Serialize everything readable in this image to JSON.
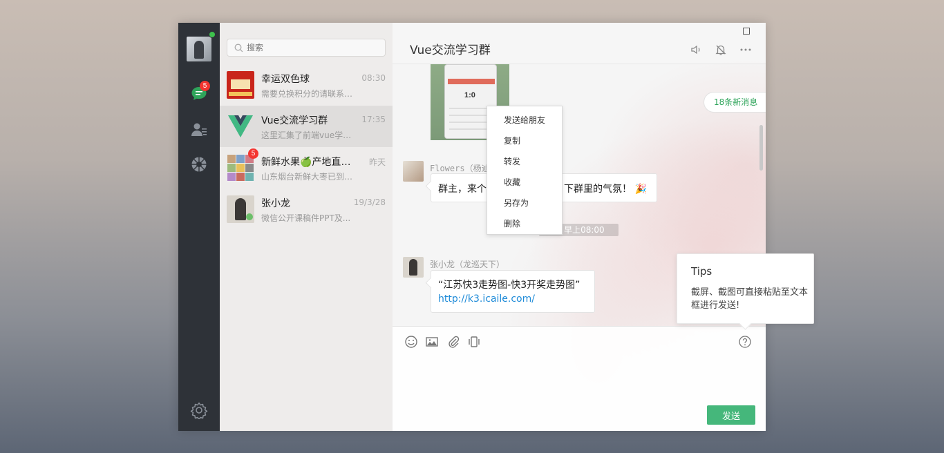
{
  "sidebar": {
    "chat_badge": "5",
    "icons": [
      "chat-icon",
      "contacts-icon",
      "moments-icon",
      "settings-icon"
    ]
  },
  "search": {
    "placeholder": "搜索"
  },
  "conversations": [
    {
      "name": "幸运双色球",
      "time": "08:30",
      "preview": "需要兑换积分的请联系Q...",
      "badge": ""
    },
    {
      "name": "Vue交流学习群",
      "time": "17:35",
      "preview": "这里汇集了前端vue学习...",
      "badge": ""
    },
    {
      "name": "新鲜水果🍏产地直邮...",
      "time": "昨天",
      "preview": "山东烟台新鲜大枣已到，欢...",
      "badge": "5"
    },
    {
      "name": "张小龙",
      "time": "19/3/28",
      "preview": "微信公开课稿件PPT及...",
      "badge": ""
    }
  ],
  "chat": {
    "title": "Vue交流学习群",
    "new_messages": "18条新消息",
    "time_divider": "日 早上08:00",
    "messages": [
      {
        "sender": "Flowers（杨迪",
        "text_left": "群主，来个",
        "text_right": "下群里的气氛！ 🎉"
      },
      {
        "sender": "张小龙（龙巡天下）",
        "quote": "“江苏快3走势图-快3开奖走势图”",
        "link": "http://k3.icaile.com/"
      }
    ],
    "image_score": "1:0"
  },
  "context_menu": [
    "发送给朋友",
    "复制",
    "转发",
    "收藏",
    "另存为",
    "删除"
  ],
  "tips": {
    "title": "Tips",
    "text": "截屏、截图可直接粘贴至文本框进行发送!"
  },
  "composer": {
    "send_label": "发送"
  },
  "colors": {
    "accent": "#45b77b",
    "sidebar": "#2e3238",
    "badge": "#f43530",
    "link": "#1f8bd8"
  }
}
